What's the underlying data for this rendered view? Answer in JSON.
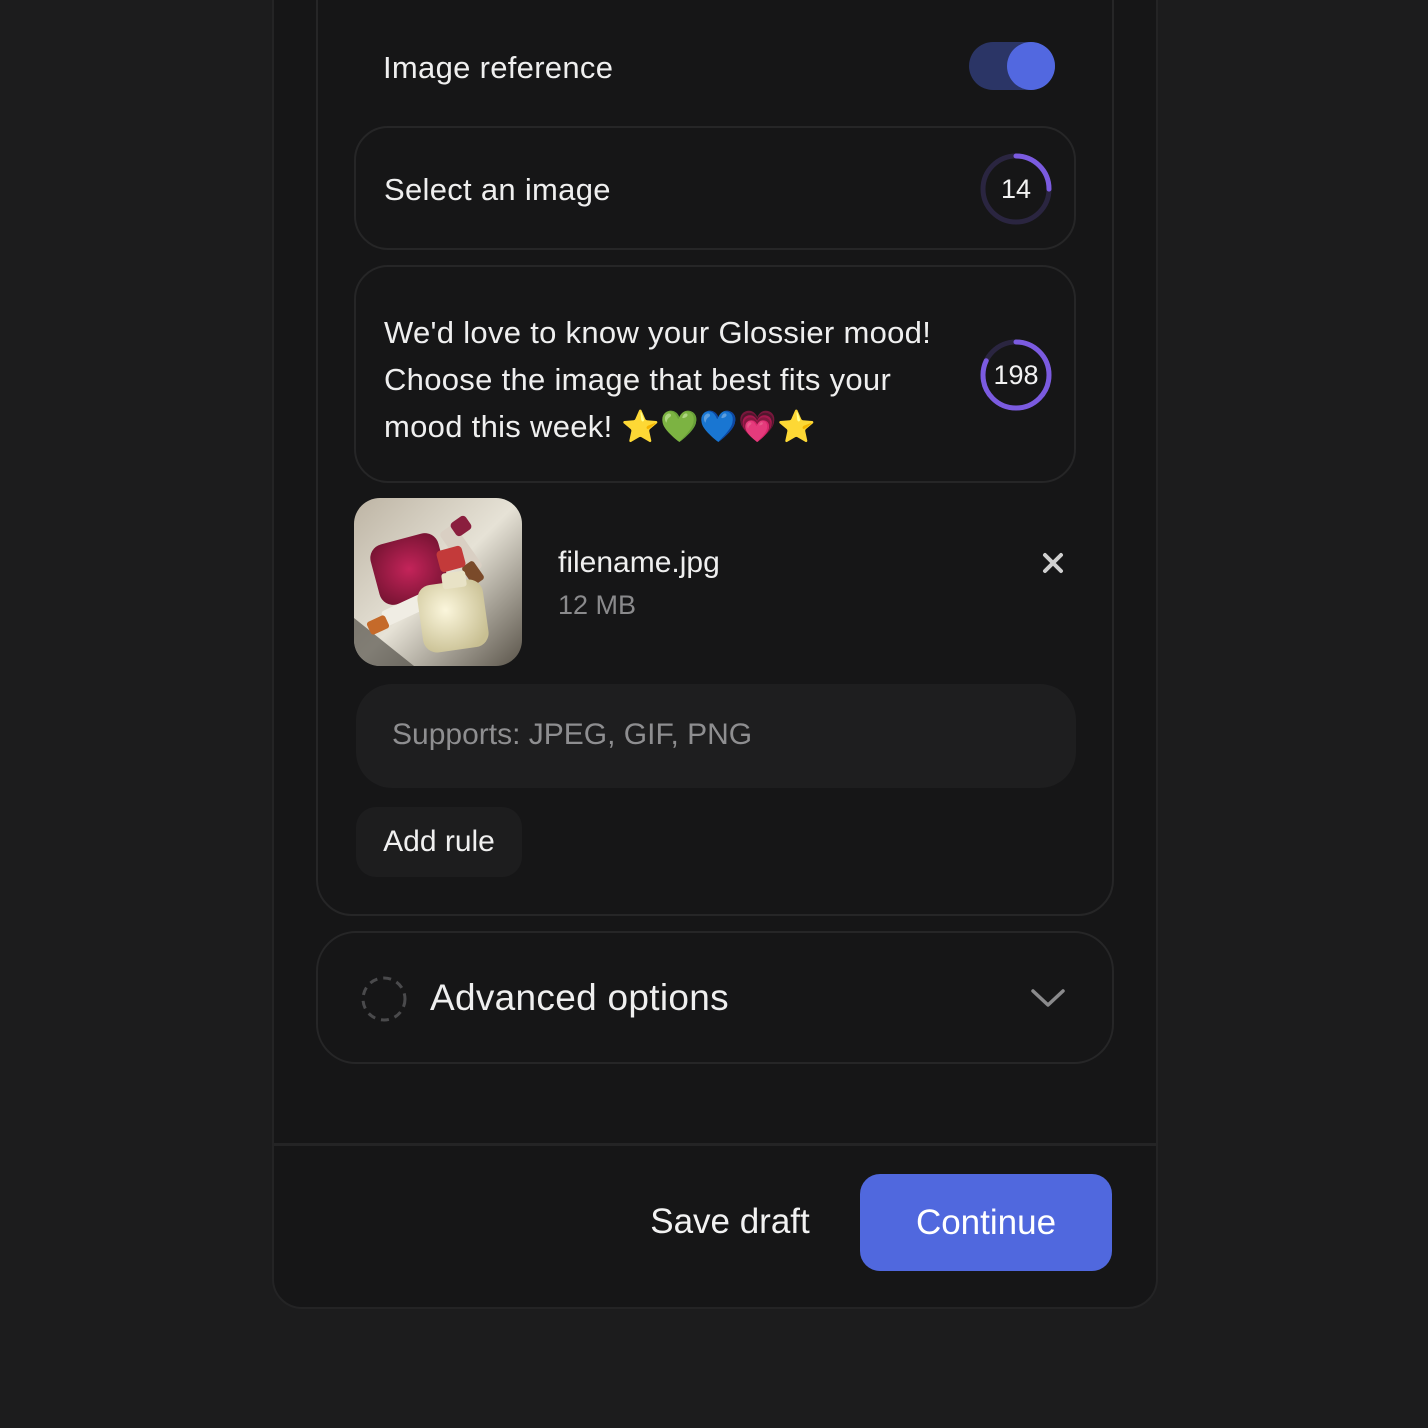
{
  "image_reference": {
    "label": "Image reference",
    "toggle_on": true
  },
  "select_field": {
    "text": "Select an image",
    "counter": "14",
    "counter_progress": 0.25
  },
  "message_field": {
    "text": "We'd love to know your Glossier mood! Choose the image that best fits your mood this week! ⭐💚💙💗⭐",
    "counter": "198",
    "counter_progress": 0.82
  },
  "attachment": {
    "filename": "filename.jpg",
    "size": "12 MB"
  },
  "supports": {
    "text": "Supports: JPEG, GIF, PNG"
  },
  "add_rule_label": "Add rule",
  "advanced": {
    "label": "Advanced options"
  },
  "footer": {
    "save_draft_label": "Save draft",
    "continue_label": "Continue"
  },
  "colors": {
    "accent": "#5068de",
    "toggle_track": "#2b3566",
    "ring": "#7b5be0",
    "ring_track": "#2a2540"
  }
}
